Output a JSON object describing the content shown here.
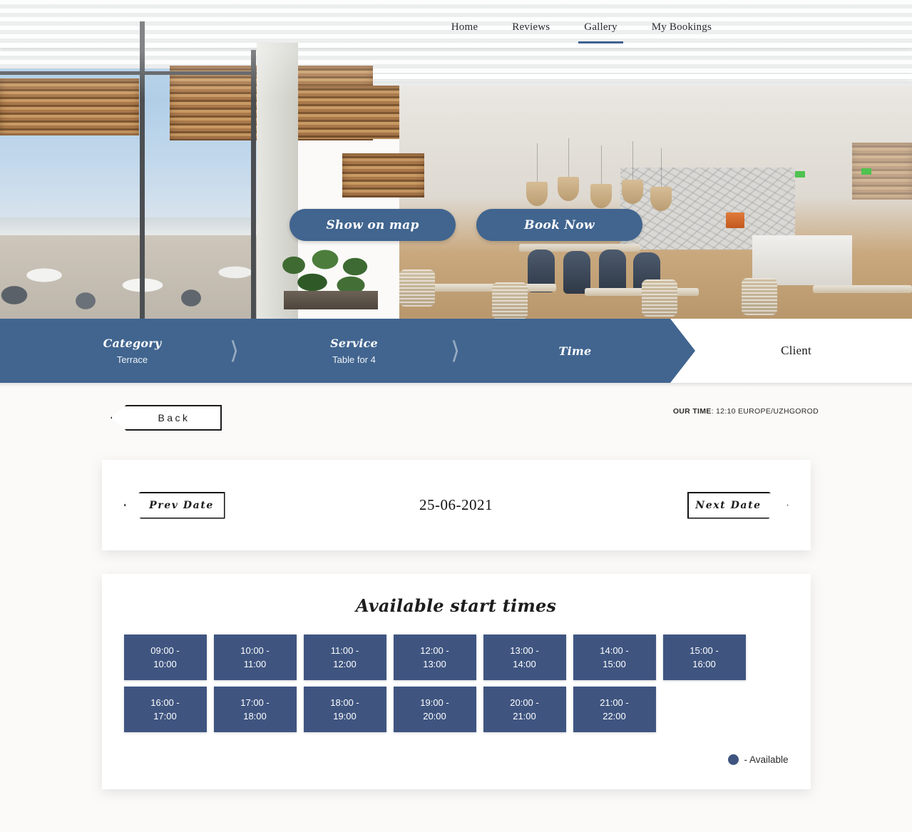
{
  "nav": {
    "items": [
      {
        "label": "Home",
        "active": false
      },
      {
        "label": "Reviews",
        "active": false
      },
      {
        "label": "Gallery",
        "active": true
      },
      {
        "label": "My Bookings",
        "active": false
      }
    ]
  },
  "hero": {
    "show_on_map_label": "Show on map",
    "book_now_label": "Book Now"
  },
  "steps": [
    {
      "title": "Category",
      "sub": "Terrace"
    },
    {
      "title": "Service",
      "sub": "Table for 4"
    },
    {
      "title": "Time",
      "sub": ""
    },
    {
      "title": "Client",
      "sub": ""
    }
  ],
  "toolbar": {
    "back_label": "Back",
    "our_time_label": "OUR TIME",
    "our_time_value": "12:10 EUROPE/UZHGOROD"
  },
  "date_nav": {
    "prev_label": "Prev Date",
    "next_label": "Next Date",
    "current_date": "25-06-2021"
  },
  "slots_panel": {
    "title": "Available start times",
    "legend_label": "- Available",
    "slots": [
      {
        "start": "09:00 -",
        "end": "10:00"
      },
      {
        "start": "10:00 -",
        "end": "11:00"
      },
      {
        "start": "11:00 -",
        "end": "12:00"
      },
      {
        "start": "12:00 -",
        "end": "13:00"
      },
      {
        "start": "13:00 -",
        "end": "14:00"
      },
      {
        "start": "14:00 -",
        "end": "15:00"
      },
      {
        "start": "15:00 -",
        "end": "16:00"
      },
      {
        "start": "16:00 -",
        "end": "17:00"
      },
      {
        "start": "17:00 -",
        "end": "18:00"
      },
      {
        "start": "18:00 -",
        "end": "19:00"
      },
      {
        "start": "19:00 -",
        "end": "20:00"
      },
      {
        "start": "20:00 -",
        "end": "21:00"
      },
      {
        "start": "21:00 -",
        "end": "22:00"
      }
    ]
  },
  "colors": {
    "brand_blue": "#41658f",
    "slot_blue": "#3f5580",
    "page_bg": "#fbfaf8"
  }
}
